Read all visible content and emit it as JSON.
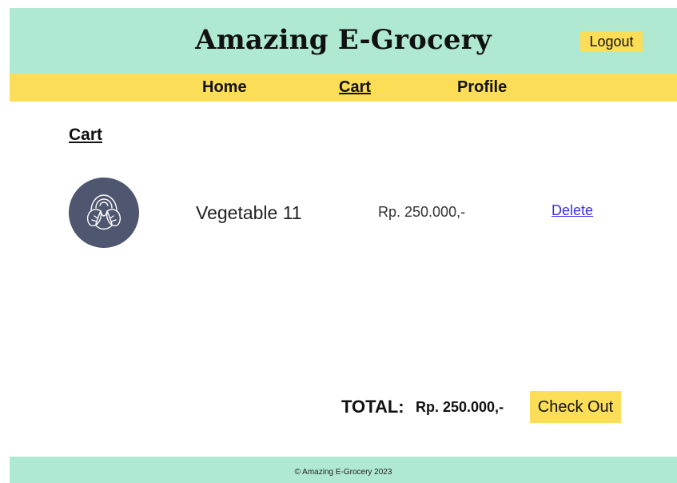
{
  "header": {
    "title": "Amazing E-Grocery",
    "logout_label": "Logout"
  },
  "nav": {
    "items": [
      {
        "label": "Home",
        "active": false
      },
      {
        "label": "Cart",
        "active": true
      },
      {
        "label": "Profile",
        "active": false
      }
    ]
  },
  "cart": {
    "heading": "Cart",
    "items": [
      {
        "image_icon": "cabbage-icon",
        "name": "Vegetable 11",
        "price": "Rp. 250.000,-",
        "delete_label": "Delete"
      }
    ],
    "total_label": "TOTAL:",
    "total_value": "Rp. 250.000,-",
    "checkout_label": "Check Out"
  },
  "footer": {
    "text": "© Amazing E-Grocery 2023"
  },
  "colors": {
    "mint": "#b0e9d1",
    "yellow": "#fbdd57",
    "link": "#3b2ee6",
    "item_image_bg": "#4e5670"
  }
}
